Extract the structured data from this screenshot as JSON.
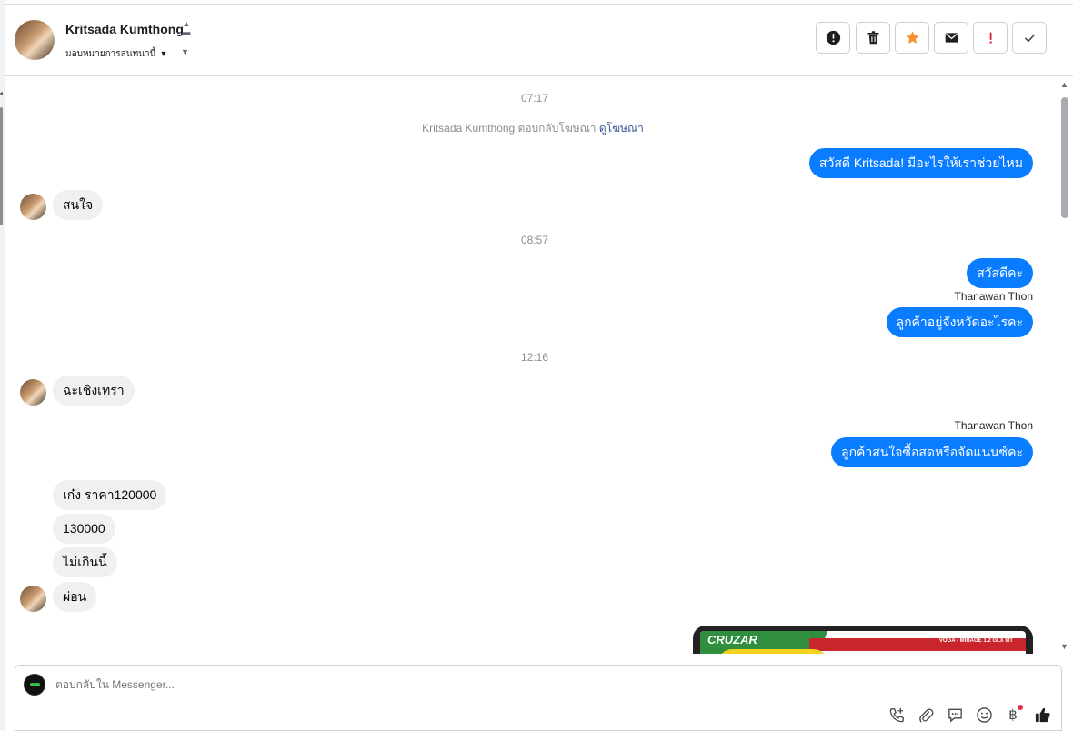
{
  "header": {
    "contact_name": "Kritsada Kumthong",
    "assign_label": "มอบหมายการสนทนานี้",
    "actions": [
      {
        "name": "report-icon",
        "label": "Report"
      },
      {
        "name": "trash-icon",
        "label": "Delete"
      },
      {
        "name": "star-icon",
        "label": "Star",
        "color": "#f5922f"
      },
      {
        "name": "envelope-icon",
        "label": "Mark unread"
      },
      {
        "name": "exclamation-icon",
        "label": "Spam",
        "color": "#e41e3f"
      },
      {
        "name": "check-icon",
        "label": "Done"
      }
    ]
  },
  "messages": {
    "ts1": "07:17",
    "system_text": "Kritsada Kumthong ตอบกลับโฆษณา",
    "system_link": "ดูโฆษณา",
    "m1": "สวัสดี Kritsada! มีอะไรให้เราช่วยไหม",
    "m2": "สนใจ",
    "ts2": "08:57",
    "m3": "สวัสดีคะ",
    "sender1": "Thanawan Thon",
    "m4": "ลูกค้าอยู่จังหวัดอะไรคะ",
    "ts3": "12:16",
    "m5": "ฉะเชิงเทรา",
    "sender2": "Thanawan Thon",
    "m6": "ลูกค้าสนใจซื้อสดหรือจัดแนนซ์คะ",
    "m7": "เก๋ง  ราคา120000",
    "m8": "130000",
    "m9": "ไม่เกินนี้",
    "m10": "ผ่อน",
    "image_text_left": "CRUZAR",
    "image_text_right": "VOGA - MIRAGE 1.2 GLX MT"
  },
  "composer": {
    "placeholder": "ตอบกลับใน Messenger...",
    "baht_symbol": "฿"
  },
  "colors": {
    "accent": "#0a7cff",
    "incoming_bubble": "#f0f0f0"
  }
}
